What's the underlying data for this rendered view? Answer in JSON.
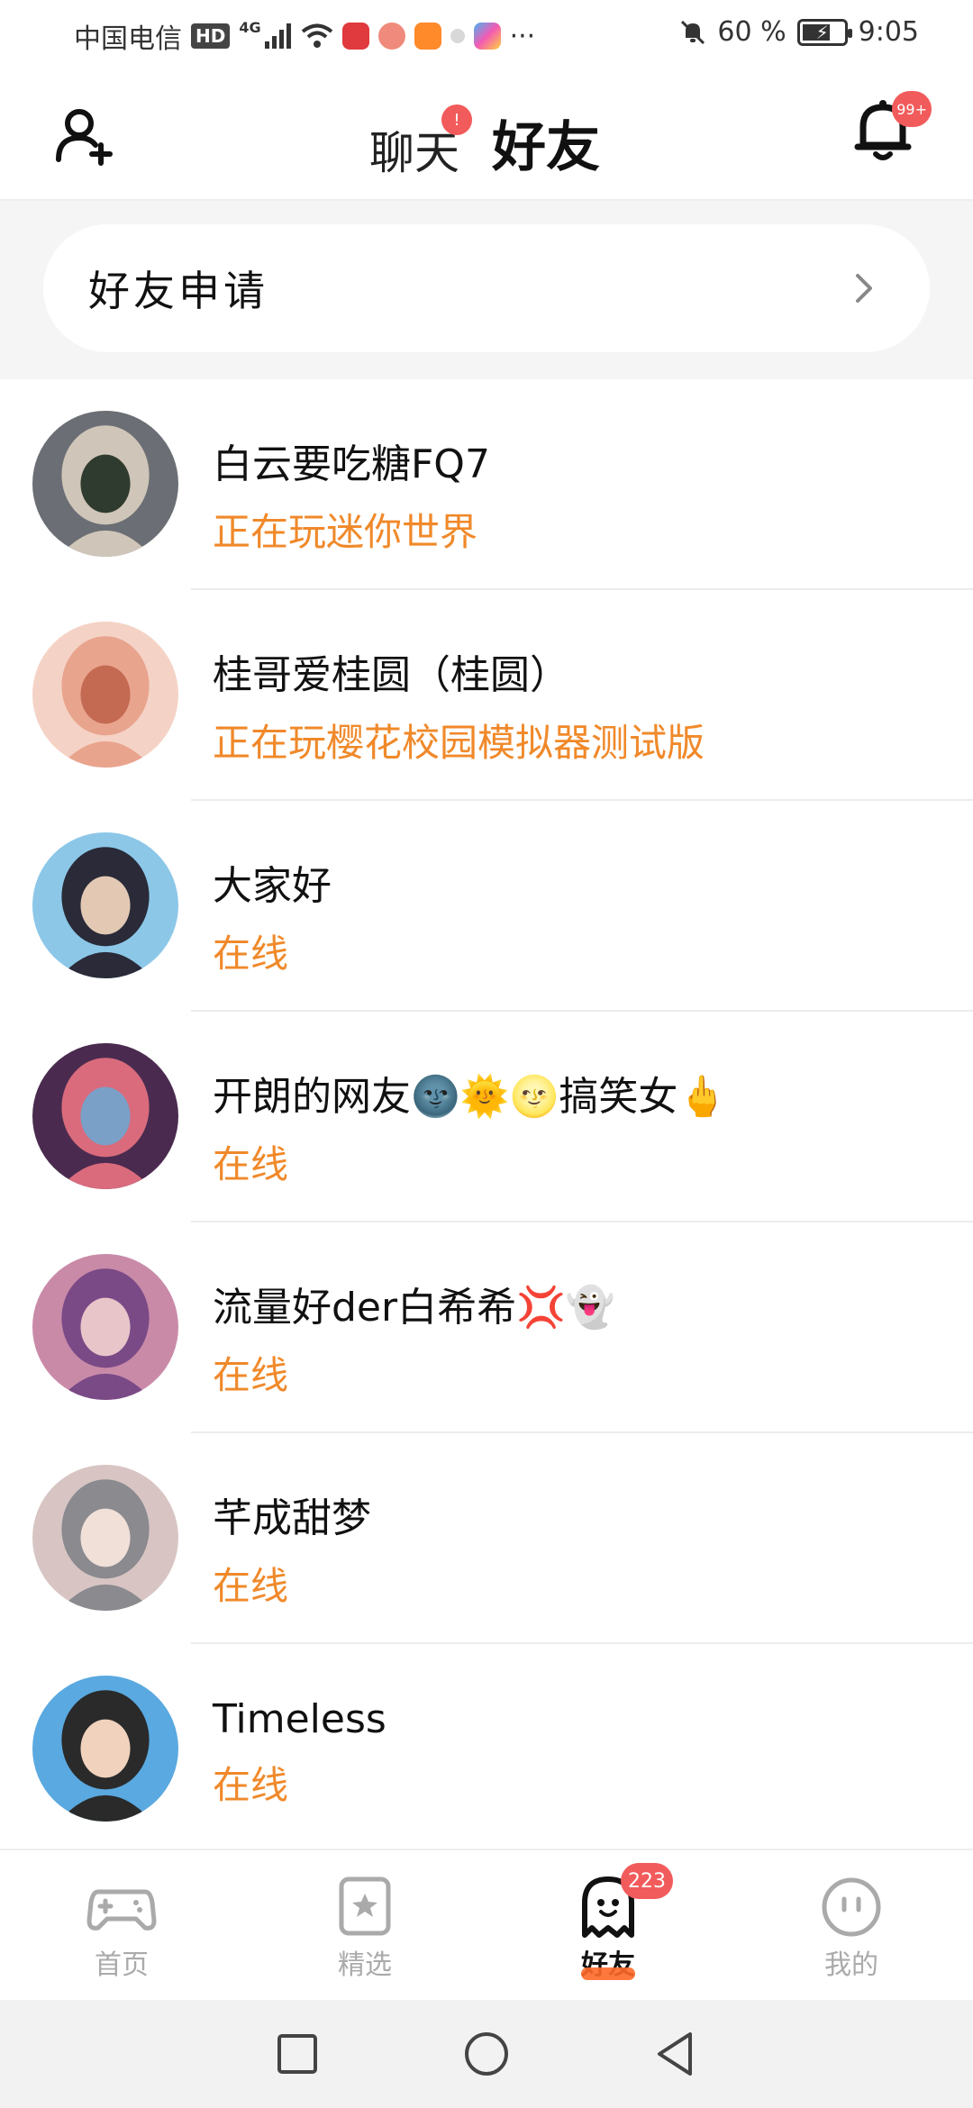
{
  "status_bar": {
    "carrier": "中国电信",
    "hd": "HD",
    "network": "4G",
    "more": "···",
    "battery": "60",
    "battery_unit": "%",
    "time": "9:05"
  },
  "header": {
    "tabs": [
      {
        "label": "聊天",
        "badge": "!"
      },
      {
        "label": "好友"
      }
    ],
    "active_tab": "好友",
    "bell_badge": "99+"
  },
  "friend_request": {
    "label": "好友申请"
  },
  "friends": [
    {
      "name": "白云要吃糖FQ7",
      "status": "正在玩迷你世界",
      "avatar_colors": [
        "#6b6e74",
        "#cfc5b8",
        "#2f3b2e"
      ]
    },
    {
      "name": "桂哥爱桂圆（桂圆）",
      "status": "正在玩樱花校园模拟器测试版",
      "avatar_colors": [
        "#f4d3c6",
        "#e9a48e",
        "#c46a52"
      ]
    },
    {
      "name": "大家好",
      "status": "在线",
      "avatar_colors": [
        "#8cc7e8",
        "#2a2a38",
        "#e3c9b4"
      ]
    },
    {
      "name": "开朗的网友🌚🌞🌝搞笑女🖕",
      "status": "在线",
      "avatar_colors": [
        "#4a2b4f",
        "#d96b7c",
        "#7aa0c8"
      ]
    },
    {
      "name": "流量好der白希希💢👻",
      "status": "在线",
      "avatar_colors": [
        "#c98aa8",
        "#7a4a86",
        "#e7c5c9"
      ]
    },
    {
      "name": "芊成甜梦",
      "status": "在线",
      "avatar_colors": [
        "#d8c5c3",
        "#8a8a8f",
        "#f1e0d8"
      ]
    },
    {
      "name": "Timeless",
      "status": "在线",
      "avatar_colors": [
        "#5aa9e0",
        "#2a2a2a",
        "#f0d2bd"
      ]
    }
  ],
  "bottom_nav": {
    "items": [
      {
        "label": "首页",
        "icon": "gamepad-icon"
      },
      {
        "label": "精选",
        "icon": "star-bookmark-icon"
      },
      {
        "label": "好友",
        "icon": "ghost-icon",
        "badge": "223"
      },
      {
        "label": "我的",
        "icon": "face-icon"
      }
    ],
    "active": "好友"
  },
  "colors": {
    "accent_orange": "#f0892a",
    "indicator": "#ff5a1f",
    "badge_red": "#f25b5b"
  }
}
